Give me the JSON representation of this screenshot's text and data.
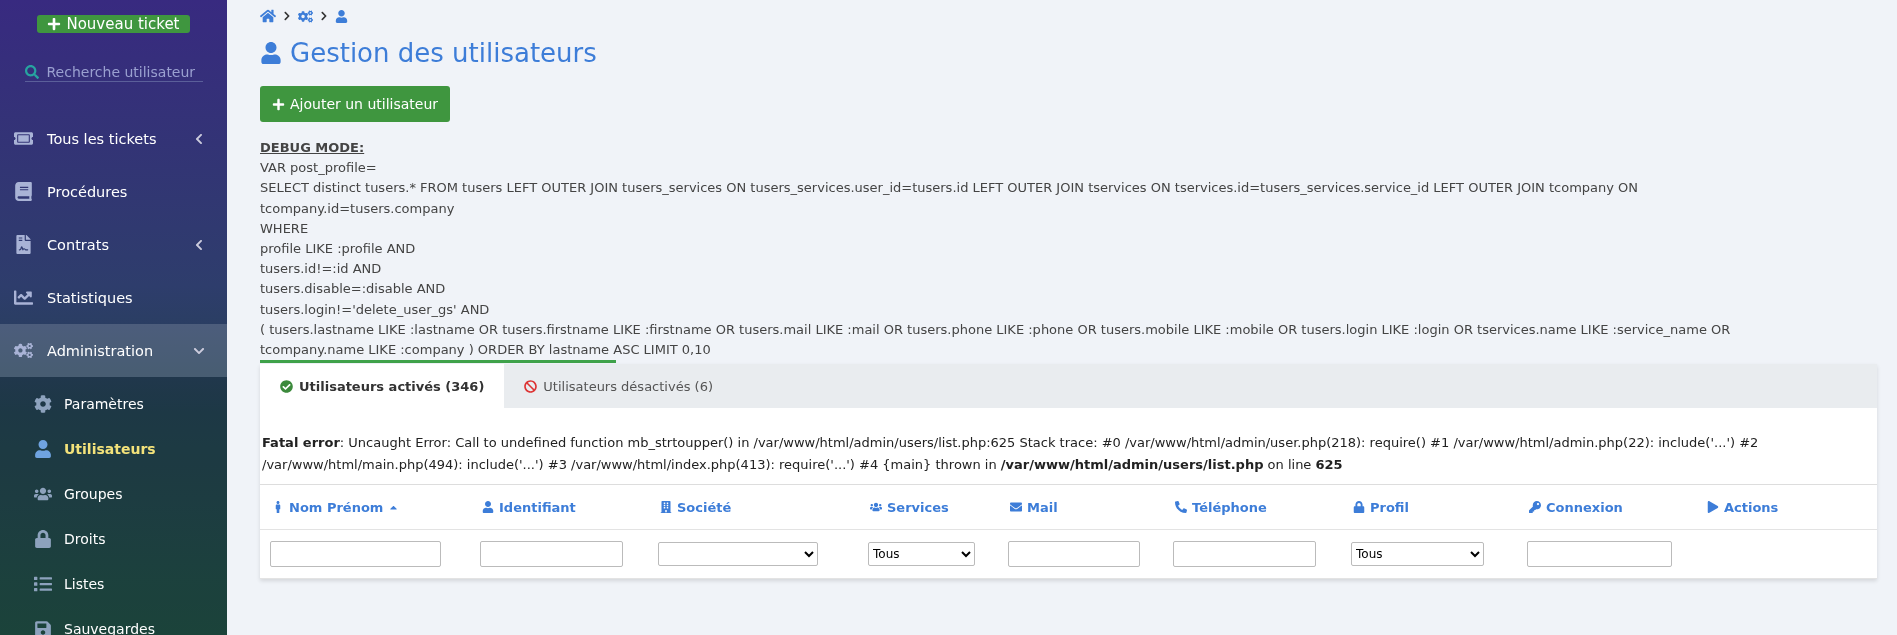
{
  "sidebar": {
    "new_ticket_button": "Nouveau ticket",
    "search": {
      "placeholder": "Recherche utilisateur"
    },
    "items": [
      {
        "label": "Tous les tickets",
        "kind": "group",
        "expanded": false,
        "selected": false
      },
      {
        "label": "Procédures",
        "kind": "link",
        "selected": false
      },
      {
        "label": "Contrats",
        "kind": "group",
        "expanded": false,
        "selected": false
      },
      {
        "label": "Statistiques",
        "kind": "link",
        "selected": false
      },
      {
        "label": "Administration",
        "kind": "group",
        "expanded": true,
        "selected": true,
        "children": [
          {
            "label": "Paramètres",
            "selected": false
          },
          {
            "label": "Utilisateurs",
            "selected": true
          },
          {
            "label": "Groupes",
            "selected": false
          },
          {
            "label": "Droits",
            "selected": false
          },
          {
            "label": "Listes",
            "selected": false
          },
          {
            "label": "Sauvegardes",
            "selected": false
          }
        ]
      }
    ]
  },
  "page": {
    "title": "Gestion des utilisateurs",
    "add_button": "Ajouter un utilisateur"
  },
  "debug": {
    "heading": "DEBUG MODE:",
    "lines": [
      "VAR post_profile=",
      "SELECT distinct tusers.* FROM tusers LEFT OUTER JOIN tusers_services ON tusers_services.user_id=tusers.id LEFT OUTER JOIN tservices ON tservices.id=tusers_services.service_id LEFT OUTER JOIN tcompany ON",
      "tcompany.id=tusers.company",
      "WHERE",
      "profile LIKE :profile AND",
      "tusers.id!=:id AND",
      "tusers.disable=:disable AND",
      "tusers.login!='delete_user_gs' AND",
      "( tusers.lastname LIKE :lastname OR tusers.firstname LIKE :firstname OR tusers.mail LIKE :mail OR tusers.phone LIKE :phone OR tusers.mobile LIKE :mobile OR tusers.login LIKE :login OR tservices.name LIKE :service_name OR",
      "tcompany.name LIKE :company ) ORDER BY lastname ASC LIMIT 0,10"
    ]
  },
  "tabs": [
    {
      "label": "Utilisateurs activés (346)",
      "kind": "enabled",
      "selected": true
    },
    {
      "label": "Utilisateurs désactivés (6)",
      "kind": "disabled",
      "selected": false
    }
  ],
  "error": "**Fatal error**: Uncaught Error: Call to undefined function mb_strtoupper() in /var/www/html/admin/users/list.php:625 Stack trace: #0 /var/www/html/admin/user.php(218): require() #1 /var/www/html/admin.php(22): include('...') #2 /var/www/html/main.php(494): include('...') #3 /var/www/html/index.php(413): require('...') #4 {main} thrown in **/var/www/html/admin/users/list.php** on line **625**",
  "table": {
    "columns": [
      {
        "label": "Nom Prénom",
        "sorted": true,
        "filter": {
          "kind": "text"
        }
      },
      {
        "label": "Identifiant",
        "sorted": false,
        "filter": {
          "kind": "text"
        }
      },
      {
        "label": "Société",
        "sorted": false,
        "filter": {
          "kind": "select"
        }
      },
      {
        "label": "Services",
        "sorted": false,
        "filter": {
          "kind": "select",
          "value": "Tous"
        }
      },
      {
        "label": "Mail",
        "sorted": false,
        "filter": {
          "kind": "text"
        }
      },
      {
        "label": "Téléphone",
        "sorted": false,
        "filter": {
          "kind": "text"
        }
      },
      {
        "label": "Profil",
        "sorted": false,
        "filter": {
          "kind": "select",
          "value": "Tous"
        }
      },
      {
        "label": "Connexion",
        "sorted": false,
        "filter": {
          "kind": "text"
        }
      },
      {
        "label": "Actions",
        "sorted": false
      }
    ]
  }
}
